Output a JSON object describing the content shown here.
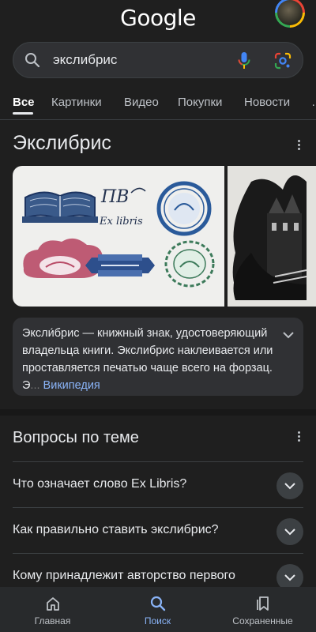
{
  "header": {
    "logo": "Google"
  },
  "search": {
    "query": "экслибрис"
  },
  "tabs": [
    {
      "label": "Все"
    },
    {
      "label": "Картинки"
    },
    {
      "label": "Видео"
    },
    {
      "label": "Покупки"
    },
    {
      "label": "Новости"
    }
  ],
  "knowledge_panel": {
    "title": "Экслибрис",
    "image1_texts": {
      "line1": "ПВ",
      "line2": "Ex libris"
    },
    "description": "Эксли́брис — книжный знак, удостоверяющий владельца книги. Экслибрис наклеивается или проставляется печатью чаще всего на форзац. Э",
    "description_ellipsis": "...",
    "source_link": "Википедия"
  },
  "related_questions": {
    "title": "Вопросы по теме",
    "items": [
      {
        "question": "Что означает слово Ex Libris?"
      },
      {
        "question": "Как правильно ставить экслибрис?"
      },
      {
        "question": "Кому принадлежит авторство первого экслибриса?"
      }
    ]
  },
  "bottom_nav": {
    "items": [
      {
        "label": "Главная",
        "icon": "home-icon"
      },
      {
        "label": "Поиск",
        "icon": "search-icon"
      },
      {
        "label": "Сохраненные",
        "icon": "bookmarks-icon"
      }
    ],
    "active_color": "#8ab4f8"
  },
  "colors": {
    "background": "#1f1f1f",
    "card": "#303134",
    "link": "#8ab4f8"
  }
}
